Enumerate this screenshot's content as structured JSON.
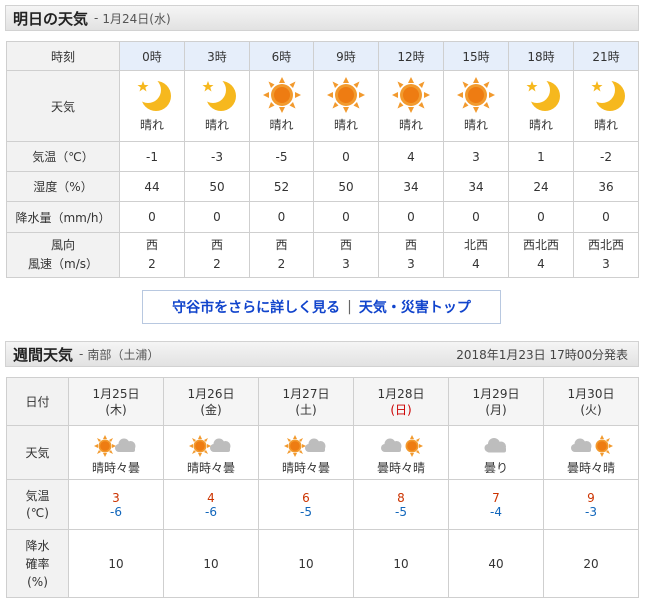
{
  "tomorrow": {
    "title": "明日の天気",
    "separator": "-",
    "date": "1月24日(水)",
    "labels": {
      "time": "時刻",
      "weather": "天気",
      "temp": "気温（℃）",
      "humidity": "湿度（%）",
      "precip": "降水量（mm/h）",
      "wind_dir": "風向",
      "wind_speed": "風速（m/s）"
    },
    "hours": [
      {
        "time": "0時",
        "icon": "moon-icon",
        "weather": "晴れ",
        "temp": "-1",
        "humidity": "44",
        "precip": "0",
        "wind_dir": "西",
        "wind_speed": "2"
      },
      {
        "time": "3時",
        "icon": "moon-icon",
        "weather": "晴れ",
        "temp": "-3",
        "humidity": "50",
        "precip": "0",
        "wind_dir": "西",
        "wind_speed": "2"
      },
      {
        "time": "6時",
        "icon": "sun-icon",
        "weather": "晴れ",
        "temp": "-5",
        "humidity": "52",
        "precip": "0",
        "wind_dir": "西",
        "wind_speed": "2"
      },
      {
        "time": "9時",
        "icon": "sun-icon",
        "weather": "晴れ",
        "temp": "0",
        "humidity": "50",
        "precip": "0",
        "wind_dir": "西",
        "wind_speed": "3"
      },
      {
        "time": "12時",
        "icon": "sun-icon",
        "weather": "晴れ",
        "temp": "4",
        "humidity": "34",
        "precip": "0",
        "wind_dir": "西",
        "wind_speed": "3"
      },
      {
        "time": "15時",
        "icon": "sun-icon",
        "weather": "晴れ",
        "temp": "3",
        "humidity": "34",
        "precip": "0",
        "wind_dir": "北西",
        "wind_speed": "4"
      },
      {
        "time": "18時",
        "icon": "moon-icon",
        "weather": "晴れ",
        "temp": "1",
        "humidity": "24",
        "precip": "0",
        "wind_dir": "西北西",
        "wind_speed": "4"
      },
      {
        "time": "21時",
        "icon": "moon-icon",
        "weather": "晴れ",
        "temp": "-2",
        "humidity": "36",
        "precip": "0",
        "wind_dir": "西北西",
        "wind_speed": "3"
      }
    ]
  },
  "links": {
    "detail": "守谷市をさらに詳しく見る",
    "separator": "|",
    "top": "天気・災害トップ"
  },
  "weekly": {
    "title": "週間天気",
    "separator": "-",
    "region": "南部（土浦）",
    "published": "2018年1月23日 17時00分発表",
    "labels": {
      "date": "日付",
      "weather": "天気",
      "temp_line1": "気温",
      "temp_line2": "(℃)",
      "precip_line1": "降水",
      "precip_line2": "確率",
      "precip_line3": "(%)"
    },
    "days": [
      {
        "date": "1月25日",
        "dow": "(木)",
        "holiday": false,
        "icon": "sun-cloud-icon",
        "weather": "晴時々曇",
        "high": "3",
        "low": "-6",
        "pop": "10"
      },
      {
        "date": "1月26日",
        "dow": "(金)",
        "holiday": false,
        "icon": "sun-cloud-icon",
        "weather": "晴時々曇",
        "high": "4",
        "low": "-6",
        "pop": "10"
      },
      {
        "date": "1月27日",
        "dow": "(土)",
        "holiday": false,
        "icon": "sun-cloud-icon",
        "weather": "晴時々曇",
        "high": "6",
        "low": "-5",
        "pop": "10"
      },
      {
        "date": "1月28日",
        "dow": "(日)",
        "holiday": true,
        "icon": "cloud-sun-icon",
        "weather": "曇時々晴",
        "high": "8",
        "low": "-5",
        "pop": "10"
      },
      {
        "date": "1月29日",
        "dow": "(月)",
        "holiday": false,
        "icon": "cloud-icon",
        "weather": "曇り",
        "high": "7",
        "low": "-4",
        "pop": "40"
      },
      {
        "date": "1月30日",
        "dow": "(火)",
        "holiday": false,
        "icon": "cloud-sun-icon",
        "weather": "曇時々晴",
        "high": "9",
        "low": "-3",
        "pop": "20"
      }
    ]
  },
  "colors": {
    "high_temp": "#cc3300",
    "low_temp": "#1166bb",
    "sunday": "#cc0000",
    "link": "#1144cc",
    "hour_header_bg": "#e6eefa"
  }
}
